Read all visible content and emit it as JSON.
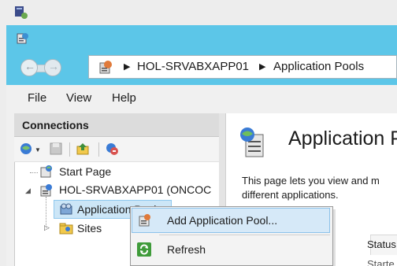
{
  "window": {
    "accent_color": "#5cc6e8",
    "app_icon": "iis-manager-icon"
  },
  "navigation": {
    "back_icon": "back-arrow-icon",
    "forward_icon": "forward-arrow-icon",
    "breadcrumb": [
      "HOL-SRVABXAPP01",
      "Application Pools"
    ],
    "separator": "▶"
  },
  "menu": {
    "file": "File",
    "view": "View",
    "help": "Help"
  },
  "connections": {
    "title": "Connections",
    "toolbar": [
      "connect-icon",
      "save-icon",
      "up-level-icon",
      "delete-connection-icon"
    ],
    "tree": {
      "start_page": "Start Page",
      "server": "HOL-SRVABXAPP01 (ONCOC",
      "server_toggle": "◢",
      "app_pools": "Application Pools",
      "sites": "Sites",
      "sites_toggle": "▷"
    }
  },
  "content": {
    "title": "Application P",
    "description_line1": "This page lets you view and m",
    "description_line2": "different applications.",
    "column_status": "Status",
    "column_status_row": "Starte"
  },
  "context_menu": {
    "items": [
      {
        "label": "Add Application Pool...",
        "icon": "add-app-pool-icon",
        "highlighted": true
      },
      {
        "label": "Refresh",
        "icon": "refresh-icon",
        "highlighted": false
      }
    ]
  }
}
